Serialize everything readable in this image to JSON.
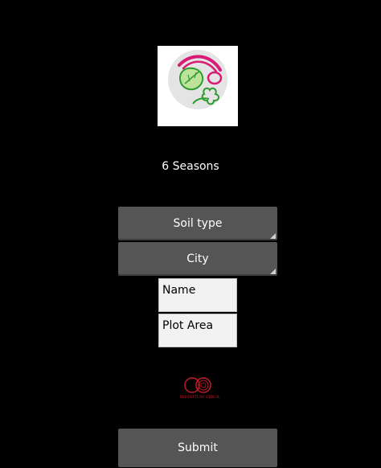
{
  "app": {
    "logo_caption": "6 seasons",
    "title": "6 Seasons"
  },
  "form": {
    "soil_type_label": "Soil type",
    "city_label": "City",
    "name_placeholder": "Name",
    "plot_area_placeholder": "Plot Area",
    "submit_label": "Submit"
  },
  "sponsor": {
    "logo_text": "INFINITUM CIRCA"
  },
  "colors": {
    "background": "#000000",
    "control": "#555555",
    "field": "#f2f2f2",
    "logo_pink": "#d81b76",
    "logo_green": "#2e9d2e"
  }
}
